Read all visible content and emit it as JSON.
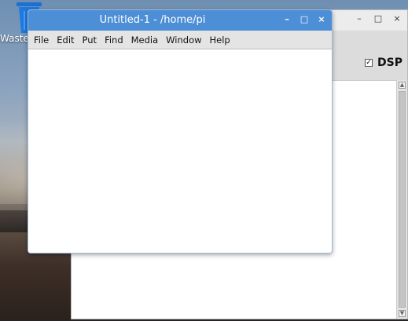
{
  "desktop": {
    "trash_label": "Waste",
    "trash_icon": "trash-can-icon"
  },
  "back_window": {
    "controls": {
      "minimize": "–",
      "maximize": "□",
      "close": "×"
    },
    "dsp_checked": true,
    "dsp_check_glyph": "✓",
    "dsp_label": "DSP",
    "scroll_up": "▲",
    "scroll_down": "▼"
  },
  "front_window": {
    "title": "Untitled-1  - /home/pi",
    "controls": {
      "minimize": "–",
      "maximize": "□",
      "close": "×"
    },
    "menu": [
      "File",
      "Edit",
      "Put",
      "Find",
      "Media",
      "Window",
      "Help"
    ],
    "accent_color": "#4d8fd6"
  }
}
